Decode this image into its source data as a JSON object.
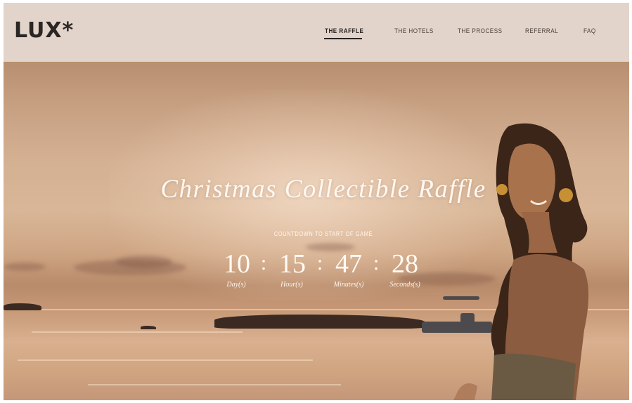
{
  "header": {
    "logo": "LUX*",
    "nav": [
      {
        "label": "THE RAFFLE",
        "active": true
      },
      {
        "label": "THE HOTELS",
        "active": false
      },
      {
        "label": "THE PROCESS",
        "active": false
      },
      {
        "label": "REFERRAL",
        "active": false
      },
      {
        "label": "FAQ",
        "active": false
      }
    ]
  },
  "hero": {
    "title": "Christmas Collectible Raffle",
    "countdown_label": "COUNTDOWN TO START OF GAME",
    "countdown": {
      "days": "10",
      "hours": "15",
      "minutes": "47",
      "seconds": "28",
      "separator": ":",
      "units": {
        "days": "Day(s)",
        "hours": "Hour(s)",
        "minutes": "Minutes(s)",
        "seconds": "Seconds(s)"
      }
    }
  },
  "colors": {
    "header_bg": "#e2d4cb",
    "logo": "#2a2624",
    "nav_text": "#4a403a",
    "hero_text": "#fffaf4"
  }
}
